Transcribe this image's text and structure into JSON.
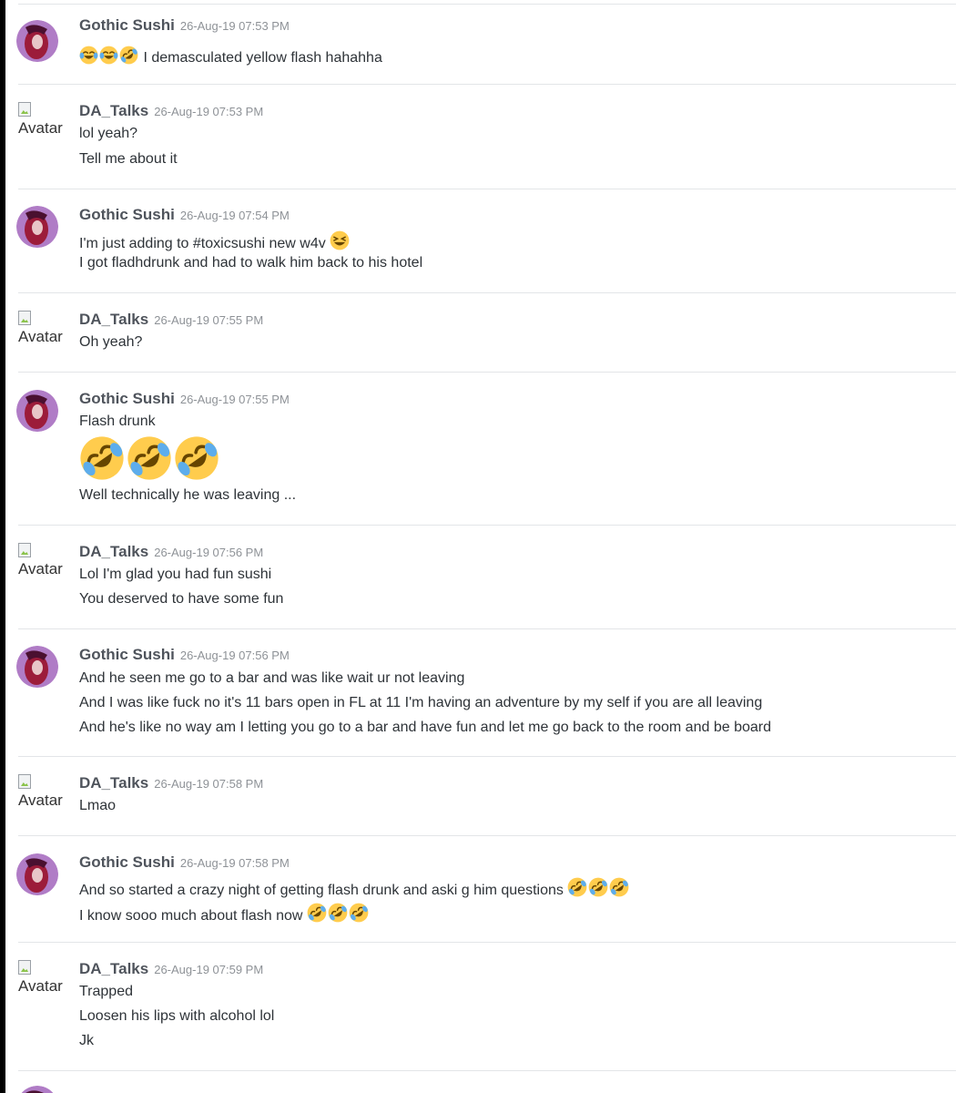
{
  "users": {
    "gothic": "Gothic Sushi",
    "da": "DA_Talks"
  },
  "avatar_alt": "Avatar",
  "messages": [
    {
      "user": "Gothic Sushi",
      "time": "26-Aug-19 07:53 PM",
      "lines": [
        {
          "emojis": [
            "joy",
            "joy",
            "rofl"
          ],
          "text": "I demasculated yellow flash hahahha"
        }
      ]
    },
    {
      "user": "DA_Talks",
      "time": "26-Aug-19 07:53 PM",
      "lines": [
        {
          "text": "lol yeah?"
        },
        {
          "text": "Tell me about it"
        }
      ]
    },
    {
      "user": "Gothic Sushi",
      "time": "26-Aug-19 07:54 PM",
      "lines": [
        {
          "text": "I'm just adding to #toxicsushi new w4v",
          "trailing_emojis": [
            "laughing"
          ]
        },
        {
          "text": "I got fladhdrunk and had to walk him back to his hotel"
        }
      ]
    },
    {
      "user": "DA_Talks",
      "time": "26-Aug-19 07:55 PM",
      "lines": [
        {
          "text": "Oh yeah?"
        }
      ]
    },
    {
      "user": "Gothic Sushi",
      "time": "26-Aug-19 07:55 PM",
      "lines": [
        {
          "text": "Flash drunk"
        },
        {
          "big_emojis": [
            "rofl",
            "rofl",
            "rofl"
          ]
        },
        {
          "text": "Well technically he was leaving ..."
        }
      ]
    },
    {
      "user": "DA_Talks",
      "time": "26-Aug-19 07:56 PM",
      "lines": [
        {
          "text": "Lol I'm glad you had fun sushi"
        },
        {
          "text": "You deserved to have some fun"
        }
      ]
    },
    {
      "user": "Gothic Sushi",
      "time": "26-Aug-19 07:56 PM",
      "lines": [
        {
          "text": "And he seen me go to a bar and was like wait ur not leaving"
        },
        {
          "text": "And I was like fuck no it's 11 bars open in FL at 11 I'm having an adventure by my self if you are all leaving"
        },
        {
          "text": "And he's like no way am I letting you go to a bar and have fun and let me go back to the room and be board"
        }
      ]
    },
    {
      "user": "DA_Talks",
      "time": "26-Aug-19 07:58 PM",
      "lines": [
        {
          "text": "Lmao"
        }
      ]
    },
    {
      "user": "Gothic Sushi",
      "time": "26-Aug-19 07:58 PM",
      "lines": [
        {
          "text": "And so started a crazy night of getting flash drunk and aski g him questions",
          "trailing_emojis": [
            "rofl",
            "rofl",
            "rofl"
          ]
        },
        {
          "text": "I know sooo much about flash now",
          "trailing_emojis": [
            "rofl",
            "rofl",
            "rofl"
          ]
        }
      ]
    },
    {
      "user": "DA_Talks",
      "time": "26-Aug-19 07:59 PM",
      "lines": [
        {
          "text": "Trapped"
        },
        {
          "text": "Loosen his lips with alcohol lol"
        },
        {
          "text": "Jk"
        }
      ]
    }
  ],
  "colors": {
    "username": "#4f545c",
    "timestamp": "#8e9297",
    "text": "#2e3338",
    "divider": "#e3e5e8",
    "emoji_face": "#ffcc4d",
    "emoji_tear": "#5dadec",
    "emoji_mouth": "#664500"
  }
}
